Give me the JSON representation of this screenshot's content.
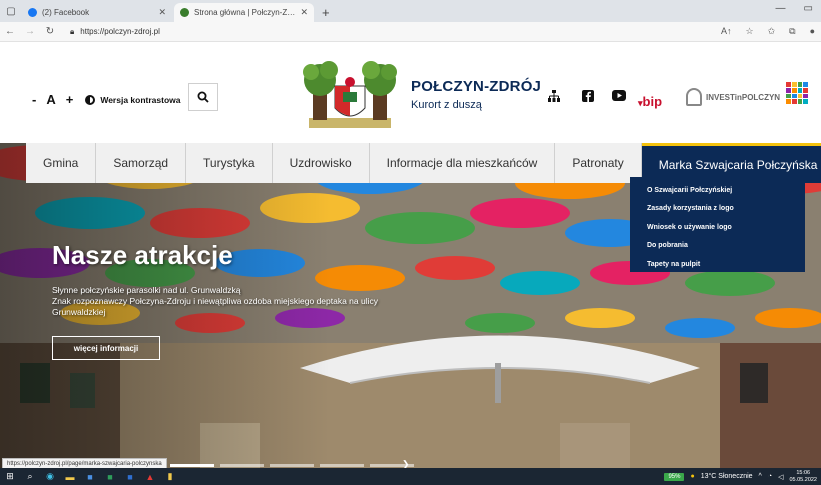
{
  "browser": {
    "tabs": [
      {
        "title": "(2) Facebook",
        "favicon_color": "#1877f2",
        "active": false
      },
      {
        "title": "Strona główna | Połczyn-Zdrój",
        "favicon_color": "#3a7d2c",
        "active": true
      }
    ],
    "new_tab_label": "+",
    "url": "https://polczyn-zdroj.pl",
    "status_url": "https://polczyn-zdroj.pl/page/marka-szwajcaria-polczynska"
  },
  "accessibility": {
    "decrease": "-",
    "font_size": "A",
    "increase": "+",
    "contrast_label": "Wersja kontrastowa"
  },
  "brand": {
    "title": "POŁCZYN-ZDRÓJ",
    "subtitle": "Kurort z duszą"
  },
  "header_links": {
    "bip": "bip",
    "invest": "INVESTinPOLCZYN"
  },
  "nav": [
    {
      "label": "Gmina"
    },
    {
      "label": "Samorząd"
    },
    {
      "label": "Turystyka"
    },
    {
      "label": "Uzdrowisko"
    },
    {
      "label": "Informacje dla mieszkańców"
    },
    {
      "label": "Patronaty"
    },
    {
      "label": "Marka Szwajcaria Połczyńska",
      "active": true
    }
  ],
  "dropdown": [
    {
      "label": "O Szwajcarii Połczyńskiej"
    },
    {
      "label": "Zasady korzystania z logo"
    },
    {
      "label": "Wniosek o używanie logo"
    },
    {
      "label": "Do pobrania"
    },
    {
      "label": "Tapety na pulpit"
    }
  ],
  "hero": {
    "title": "Nasze atrakcje",
    "line1": "Słynne połczyńskie parasolki nad ul. Grunwaldzką",
    "line2": "Znak rozpoznawczy Połczyna-Zdroju i niewątpliwa ozdoba miejskiego deptaka na ulicy Grunwaldzkiej",
    "button": "więcej informacji"
  },
  "taskbar": {
    "battery": "95%",
    "weather": "13°C Słonecznie",
    "time": "15:06",
    "date": "05.05.2022"
  },
  "colors": {
    "navy": "#0c2a56",
    "accent_yellow": "#f4c20d",
    "bip_red": "#c8102e"
  }
}
